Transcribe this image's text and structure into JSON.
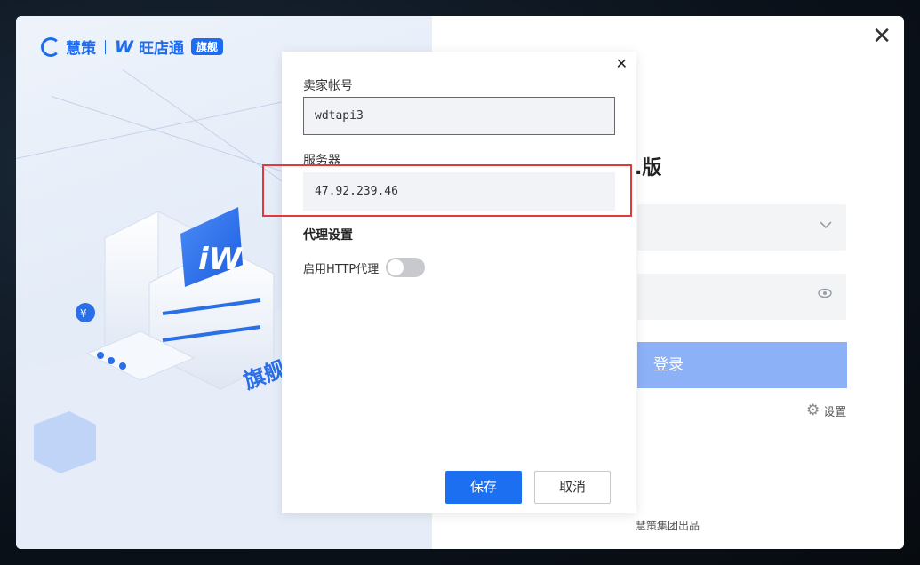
{
  "brand": {
    "name_1": "慧策",
    "name_2": "旺店通",
    "badge": "旗舰"
  },
  "login": {
    "title_partial": ".版",
    "button": "登录",
    "settings": "设置",
    "footer": "慧策集团出品",
    "icons": {
      "dropdown": "chevron-down-icon",
      "password": "eye-icon",
      "settings": "gear-icon"
    }
  },
  "dialog": {
    "seller_account_label": "卖家帐号",
    "seller_account_value": "wdtapi3",
    "server_label": "服务器",
    "server_value": "47.92.239.46",
    "proxy_section": "代理设置",
    "proxy_toggle_label": "启用HTTP代理",
    "proxy_enabled": false,
    "save": "保存",
    "cancel": "取消"
  },
  "colors": {
    "primary": "#1d6ff2",
    "login_button": "#8db1f6",
    "highlight": "#e03a3a"
  }
}
